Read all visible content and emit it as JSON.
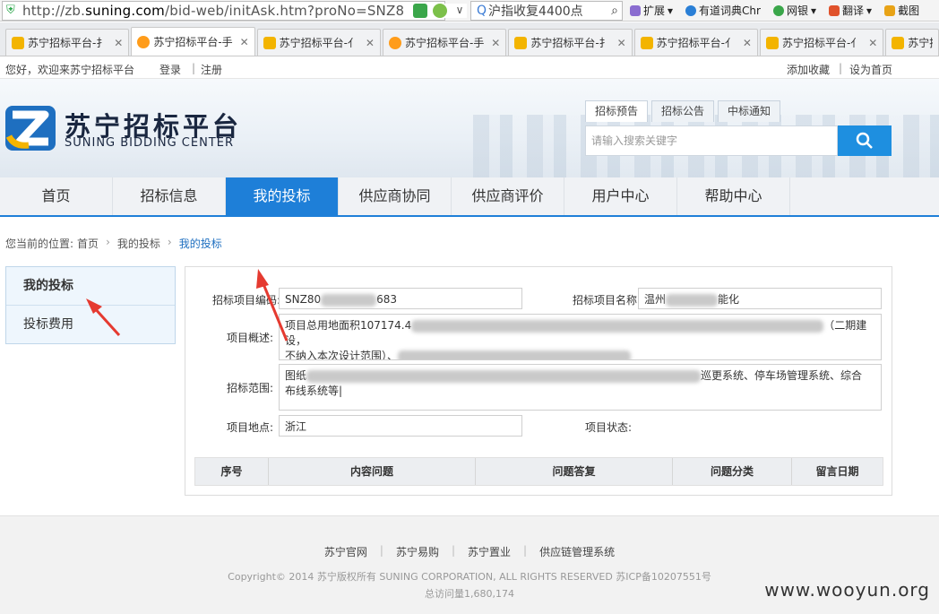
{
  "browser": {
    "url_prefix": "http://zb.",
    "url_domain": "suning.com",
    "url_rest": "/bid-web/initAsk.htm?proNo=SNZ8",
    "search_text": "沪指收复4400点",
    "toolbar": [
      "扩展",
      "有道词典Chr",
      "网银",
      "翻译",
      "截图"
    ],
    "tabs": [
      {
        "title": "苏宁招标平台-扌",
        "icon": "page-icon",
        "active": false
      },
      {
        "title": "苏宁招标平台-手",
        "icon": "lion-icon",
        "active": true
      },
      {
        "title": "苏宁招标平台-亻",
        "icon": "page-icon",
        "active": false
      },
      {
        "title": "苏宁招标平台-手",
        "icon": "lion-icon",
        "active": false
      },
      {
        "title": "苏宁招标平台-扌",
        "icon": "page-icon",
        "active": false
      },
      {
        "title": "苏宁招标平台-亻",
        "icon": "page-icon",
        "active": false
      },
      {
        "title": "苏宁招标平台-亻",
        "icon": "page-icon",
        "active": false
      },
      {
        "title": "苏宁招标平台",
        "icon": "page-icon",
        "active": false
      }
    ]
  },
  "toplinks": {
    "welcome": "您好，欢迎来苏宁招标平台",
    "login": "登录",
    "sep": "|",
    "register": "注册",
    "favorite": "添加收藏",
    "set_home": "设为首页"
  },
  "header": {
    "logo_cn": "苏宁招标平台",
    "logo_en": "SUNING BIDDING CENTER",
    "search_tabs": [
      "招标预告",
      "招标公告",
      "中标通知"
    ],
    "search_placeholder": "请输入搜索关键字"
  },
  "nav": [
    "首页",
    "招标信息",
    "我的投标",
    "供应商协同",
    "供应商评价",
    "用户中心",
    "帮助中心"
  ],
  "breadcrumb": {
    "prefix": "您当前的位置:",
    "items": [
      "首页",
      "我的投标",
      "我的投标"
    ]
  },
  "sidebar": {
    "items": [
      "我的投标",
      "投标费用"
    ]
  },
  "form": {
    "code_label": "招标项目编码:",
    "code_a": "SNZ80",
    "code_b": "683",
    "name_label": "招标项目名称:",
    "name_a": "温州",
    "name_b": "能化",
    "overview_label": "项目概述:",
    "overview_a": "项目总用地面积107174.4",
    "overview_b": "（二期建设，",
    "overview_line2": "不纳入本次设计范围）、",
    "scope_label": "招标范围:",
    "scope_a": "图纸",
    "scope_b": "巡更系统、停车场管理系统、综合",
    "scope_line2": "布线系统等",
    "location_label": "项目地点:",
    "location_value": "浙江",
    "status_label": "项目状态:",
    "status_value": ""
  },
  "qtable": {
    "headers": [
      "序号",
      "内容问题",
      "问题答复",
      "问题分类",
      "留言日期"
    ]
  },
  "footer": {
    "links": [
      "苏宁官网",
      "苏宁易购",
      "苏宁置业",
      "供应链管理系统"
    ],
    "copyright": "Copyright© 2014 苏宁版权所有 SUNING CORPORATION, ALL RIGHTS RESERVED 苏ICP备10207551号",
    "visits": "总访问量1,680,174",
    "watermark": "www.wooyun.org"
  },
  "colors": {
    "nav_active": "#1e7fd8",
    "search_button": "#1e8fe0",
    "annotation_arrow": "#e53a30"
  }
}
